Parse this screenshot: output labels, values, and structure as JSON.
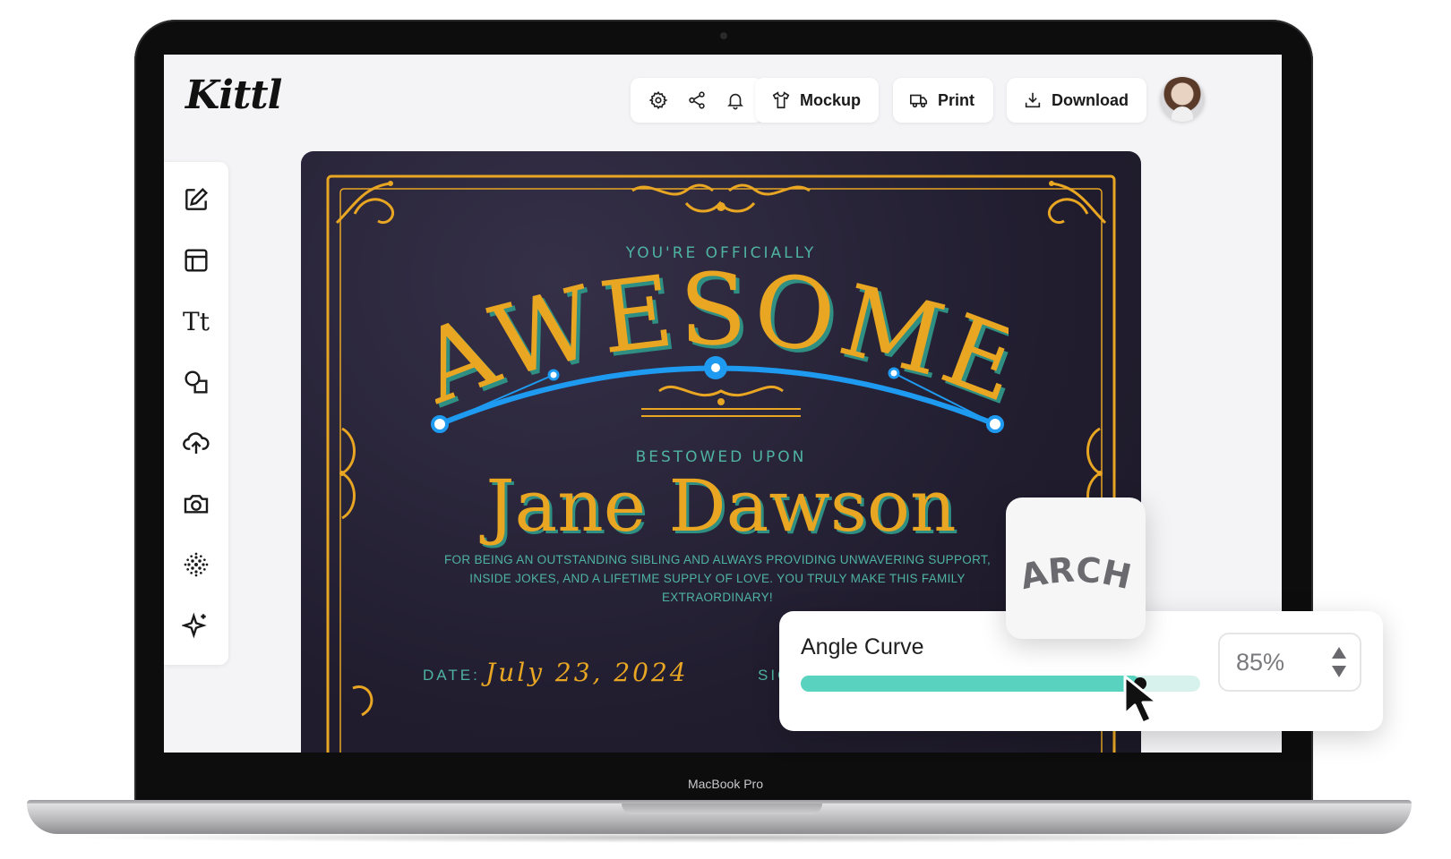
{
  "app": {
    "logo": "Kittl"
  },
  "device": {
    "label": "MacBook Pro"
  },
  "header": {
    "icons": [
      "settings-icon",
      "share-icon",
      "bell-icon"
    ],
    "mockup_label": "Mockup",
    "print_label": "Print",
    "download_label": "Download"
  },
  "sidebar": {
    "items": [
      {
        "name": "edit",
        "icon": "edit-icon"
      },
      {
        "name": "templates",
        "icon": "layout-icon"
      },
      {
        "name": "text",
        "icon": "text-icon",
        "glyph": "Tt"
      },
      {
        "name": "shapes",
        "icon": "shapes-icon"
      },
      {
        "name": "uploads",
        "icon": "upload-icon"
      },
      {
        "name": "photos",
        "icon": "camera-icon"
      },
      {
        "name": "halftone",
        "icon": "halftone-icon"
      },
      {
        "name": "ai",
        "icon": "sparkle-icon"
      }
    ]
  },
  "certificate": {
    "subtitle_top": "YOU'RE OFFICIALLY",
    "headline": "AWESOME",
    "subtitle_mid": "BESTOWED UPON",
    "name": "Jane Dawson",
    "body": "FOR BEING AN OUTSTANDING SIBLING AND ALWAYS PROVIDING UNWAVERING SUPPORT, INSIDE JOKES, AND A LIFETIME SUPPLY OF LOVE. YOU TRULY MAKE THIS FAMILY EXTRAORDINARY!",
    "date_label": "DATE:",
    "date_value": "July 23, 2024",
    "signature_label": "SIG"
  },
  "text_effect": {
    "label": "ARCH"
  },
  "angle_curve": {
    "label": "Angle Curve",
    "value": 0.85,
    "value_text": "85%"
  },
  "colors": {
    "gold": "#e8a623",
    "teal": "#4fb3a2",
    "slider": "#59d3bf",
    "handle_blue": "#1e9bf0",
    "canvas_bg": "#211d2f"
  }
}
